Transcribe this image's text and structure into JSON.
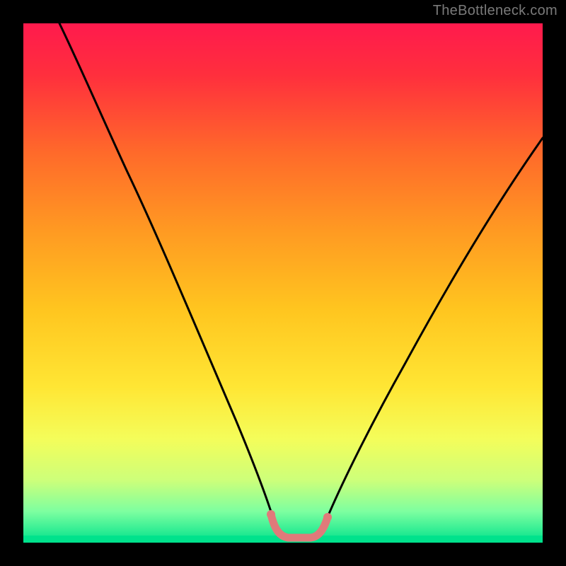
{
  "watermark": "TheBottleneck.com",
  "colors": {
    "gradient_stops": [
      {
        "offset": 0.0,
        "color": "#ff1a4d"
      },
      {
        "offset": 0.1,
        "color": "#ff2f3d"
      },
      {
        "offset": 0.25,
        "color": "#ff6a2a"
      },
      {
        "offset": 0.4,
        "color": "#ff9a22"
      },
      {
        "offset": 0.55,
        "color": "#ffc51f"
      },
      {
        "offset": 0.7,
        "color": "#ffe634"
      },
      {
        "offset": 0.8,
        "color": "#f4fd5a"
      },
      {
        "offset": 0.88,
        "color": "#cdff7a"
      },
      {
        "offset": 0.94,
        "color": "#7dffa0"
      },
      {
        "offset": 1.0,
        "color": "#00e28c"
      }
    ],
    "green_band": "#00e28c",
    "curve_main": "#000000",
    "curve_highlight": "#e07a7a"
  },
  "chart_data": {
    "type": "line",
    "title": "",
    "xlabel": "",
    "ylabel": "",
    "x_range": [
      0,
      100
    ],
    "y_range": [
      0,
      100
    ],
    "grid": false,
    "legend": false,
    "series": [
      {
        "name": "curve",
        "x": [
          7,
          12,
          17,
          22,
          27,
          32,
          37,
          42,
          46,
          48,
          50,
          52,
          54,
          56,
          58,
          63,
          70,
          80,
          90,
          100
        ],
        "y": [
          100,
          89,
          78,
          67,
          56,
          45,
          34,
          23,
          12,
          7,
          3,
          2,
          2,
          3,
          7,
          15,
          27,
          45,
          62,
          78
        ],
        "note": "y estimated as percent of plot height from bottom; minimum (zero-bottleneck) around x≈50–55"
      }
    ],
    "highlight_region": {
      "x_start": 47,
      "x_end": 57,
      "description": "flat bottom of curve drawn in salmon/pink"
    }
  }
}
